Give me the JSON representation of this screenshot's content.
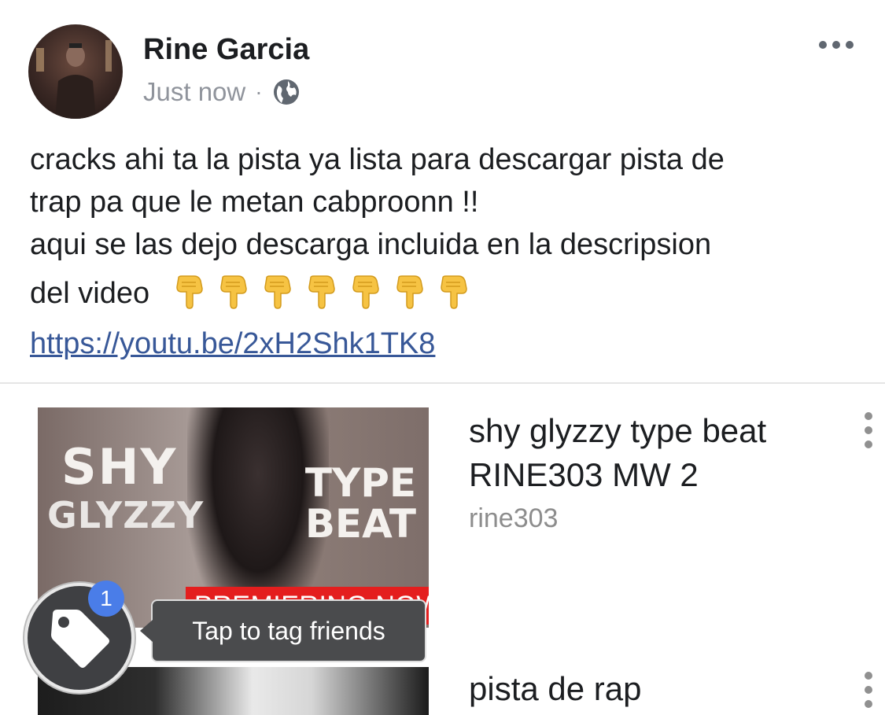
{
  "post": {
    "author": "Rine Garcia",
    "timestamp": "Just now",
    "separator": "·",
    "privacy_icon": "globe-icon",
    "more_icon": "more-horizontal-icon",
    "text_lines": [
      "cracks ahi ta la pista ya lista para descargar pista de",
      "trap pa que le metan cabproonn !!",
      "aqui se las dejo descarga incluida en la descripsion",
      "del video"
    ],
    "emoji": "backhand-index-pointing-down",
    "emoji_count": 7,
    "link": "https://youtu.be/2xH2Shk1TK8"
  },
  "videos": [
    {
      "title": "shy glyzzy type beat RINE303 MW 2",
      "channel": "rine303",
      "thumbnail": {
        "text_shy": "SHY",
        "text_glyzzy": "GLYZZY",
        "text_type": "TYPE",
        "text_beat": "BEAT",
        "badge": "PREMIERING NOW"
      }
    },
    {
      "title": "pista de rap"
    }
  ],
  "tag_tooltip": {
    "text": "Tap to tag friends",
    "badge_count": "1",
    "icon": "tag-icon"
  },
  "colors": {
    "link": "#385898",
    "premiere_red": "#e41e1e",
    "badge_blue": "#4a7de8"
  }
}
